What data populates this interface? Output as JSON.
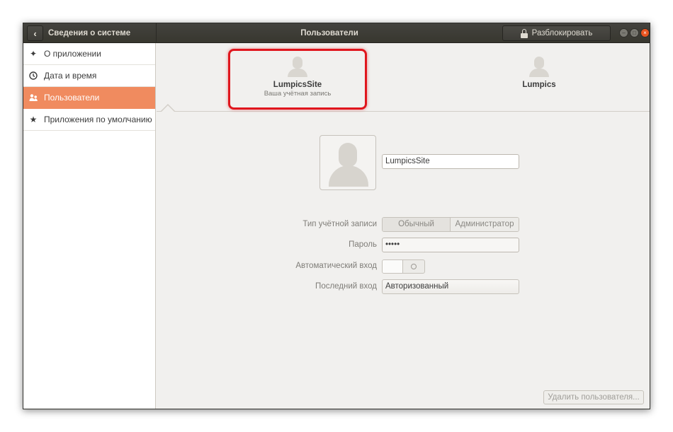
{
  "header": {
    "back_label": "<",
    "left_title": "Сведения о системе",
    "center_title": "Пользователи",
    "unlock_label": "Разблокировать"
  },
  "sidebar": {
    "items": [
      {
        "label": "О приложении",
        "icon": "sparkle-icon",
        "active": false
      },
      {
        "label": "Дата и время",
        "icon": "clock-icon",
        "active": false
      },
      {
        "label": "Пользователи",
        "icon": "users-icon",
        "active": true
      },
      {
        "label": "Приложения по умолчанию",
        "icon": "star-icon",
        "active": false
      }
    ]
  },
  "users": [
    {
      "name": "LumpicsSite",
      "subtitle": "Ваша учётная запись",
      "selected": true
    },
    {
      "name": "Lumpics",
      "subtitle": "",
      "selected": false
    }
  ],
  "form": {
    "username_value": "LumpicsSite",
    "account_type_label": "Тип учётной записи",
    "account_type_options": [
      "Обычный",
      "Администратор"
    ],
    "account_type_selected": "Обычный",
    "password_label": "Пароль",
    "password_value": "•••••",
    "autologin_label": "Автоматический вход",
    "autologin_on": false,
    "last_login_label": "Последний вход",
    "last_login_value": "Авторизованный"
  },
  "footer": {
    "delete_label": "Удалить пользователя..."
  },
  "colors": {
    "accent": "#f08b5f",
    "highlight": "#e0161d",
    "headerbar": "#3c3b37"
  }
}
